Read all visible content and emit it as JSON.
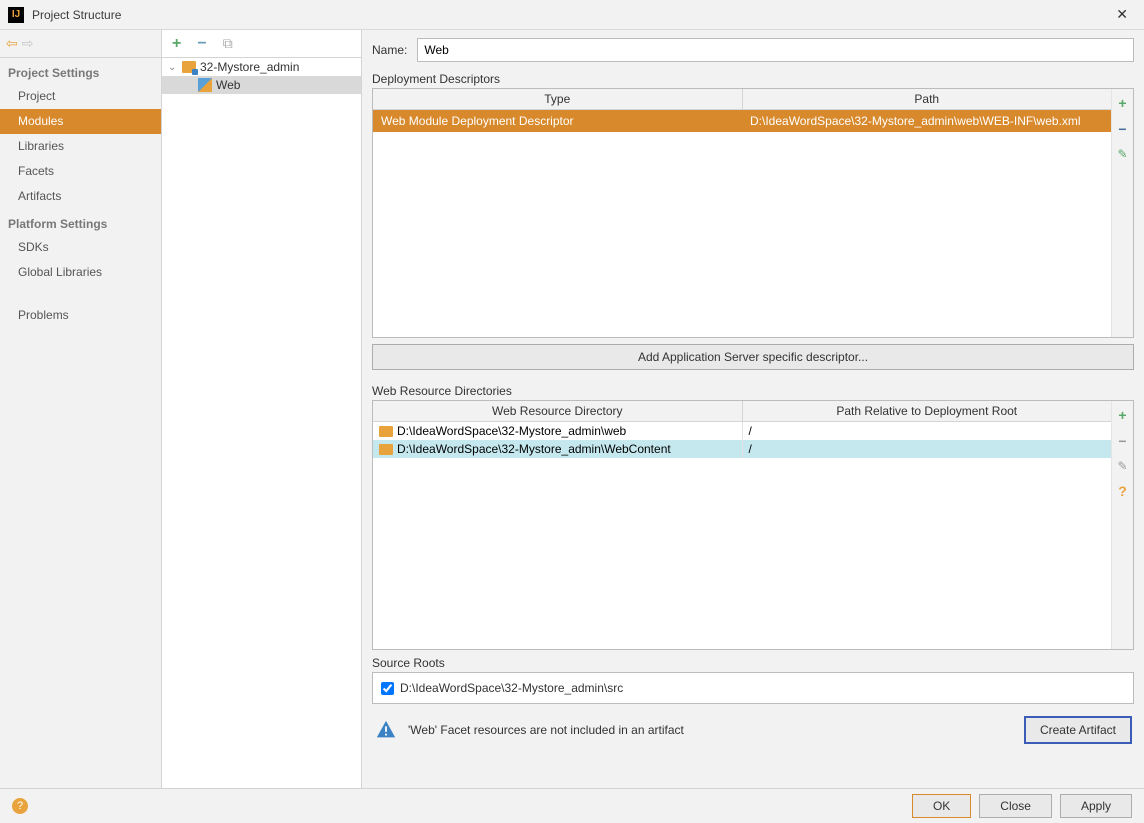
{
  "window": {
    "title": "Project Structure"
  },
  "sidebar": {
    "sections": [
      {
        "header": "Project Settings",
        "items": [
          "Project",
          "Modules",
          "Libraries",
          "Facets",
          "Artifacts"
        ],
        "selected": "Modules"
      },
      {
        "header": "Platform Settings",
        "items": [
          "SDKs",
          "Global Libraries"
        ]
      }
    ],
    "problems": "Problems"
  },
  "tree": {
    "root": "32-Mystore_admin",
    "child": "Web"
  },
  "name": {
    "label": "Name:",
    "value": "Web"
  },
  "deployment_descriptors": {
    "label": "Deployment Descriptors",
    "headers": [
      "Type",
      "Path"
    ],
    "rows": [
      {
        "type": "Web Module Deployment Descriptor",
        "path": "D:\\IdeaWordSpace\\32-Mystore_admin\\web\\WEB-INF\\web.xml"
      }
    ],
    "add_button": "Add Application Server specific descriptor..."
  },
  "web_resource_directories": {
    "label": "Web Resource Directories",
    "headers": [
      "Web Resource Directory",
      "Path Relative to Deployment Root"
    ],
    "rows": [
      {
        "dir": "D:\\IdeaWordSpace\\32-Mystore_admin\\web",
        "path": "/"
      },
      {
        "dir": "D:\\IdeaWordSpace\\32-Mystore_admin\\WebContent",
        "path": "/"
      }
    ]
  },
  "source_roots": {
    "label": "Source Roots",
    "items": [
      "D:\\IdeaWordSpace\\32-Mystore_admin\\src"
    ]
  },
  "warning": {
    "text": "'Web' Facet resources are not included in an artifact",
    "button": "Create Artifact"
  },
  "footer": {
    "ok": "OK",
    "close": "Close",
    "apply": "Apply"
  }
}
